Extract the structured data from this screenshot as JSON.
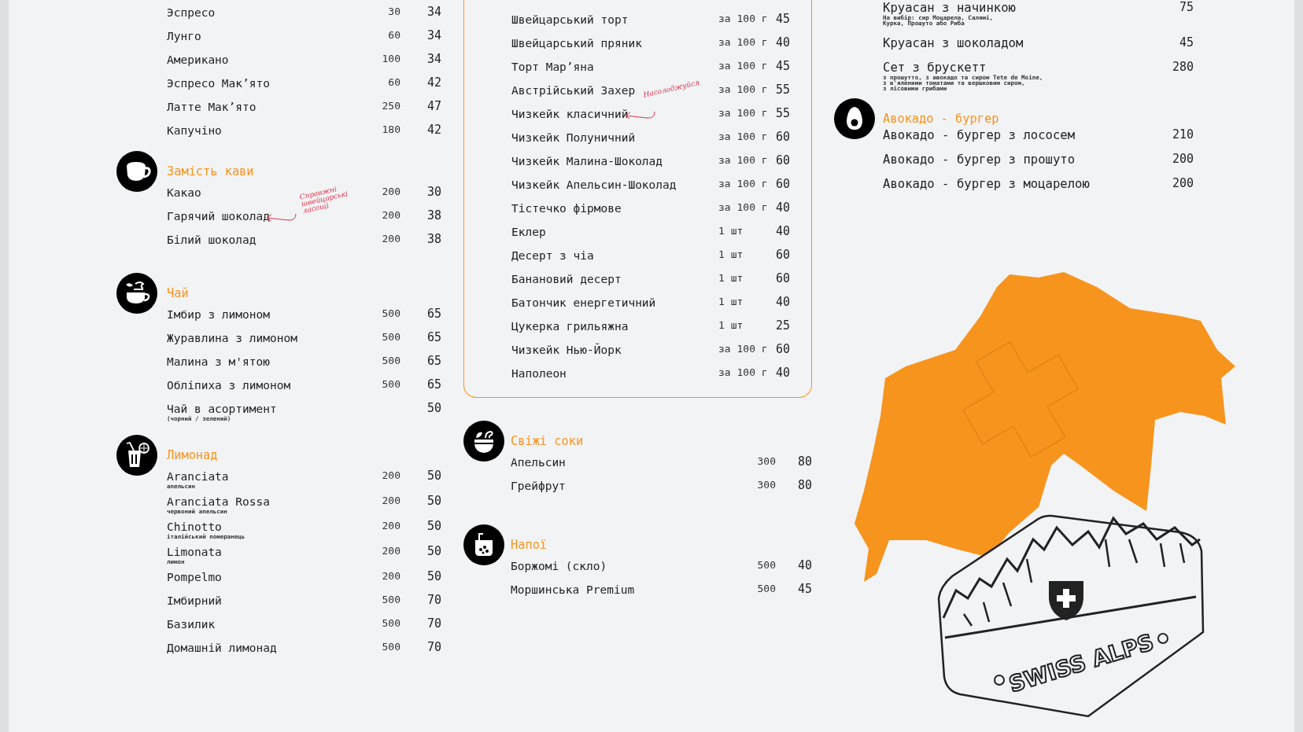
{
  "left_column": {
    "sections": [
      {
        "items": [
          {
            "name": "Эспресо",
            "amount": "30",
            "price": "34"
          },
          {
            "name": "Лунго",
            "amount": "60",
            "price": "34"
          },
          {
            "name": "Американо",
            "amount": "100",
            "price": "34"
          },
          {
            "name": "Эспресо Мак’ято",
            "amount": "60",
            "price": "42"
          },
          {
            "name": "Латте Мак’ято",
            "amount": "250",
            "price": "47"
          },
          {
            "name": "Капучіно",
            "amount": "180",
            "price": "42"
          }
        ]
      },
      {
        "kind": "cup",
        "title": "Замість кави",
        "items": [
          {
            "name": "Какао",
            "amount": "200",
            "price": "30"
          },
          {
            "name": "Гарячий шоколад",
            "amount": "200",
            "price": "38",
            "handwritten_note": "Справжні швейцарські ласощі"
          },
          {
            "name": "Білий шоколад",
            "amount": "200",
            "price": "38"
          }
        ]
      },
      {
        "kind": "tea",
        "title": "Чай",
        "items": [
          {
            "name": "Імбир з лимоном",
            "amount": "500",
            "price": "65"
          },
          {
            "name": "Журавлина з лимоном",
            "amount": "500",
            "price": "65"
          },
          {
            "name": "Малина з м'ятою",
            "amount": "500",
            "price": "65"
          },
          {
            "name": "Обліпиха з лимоном",
            "amount": "500",
            "price": "65"
          },
          {
            "name": "Чай в асортимент",
            "note": "(чорний / зелений)",
            "price": "50"
          }
        ]
      },
      {
        "kind": "lemonade",
        "title": "Лимонад",
        "items": [
          {
            "name": "Aranciata",
            "note": "апельсин",
            "amount": "200",
            "price": "50"
          },
          {
            "name": "Aranciata Rossa",
            "note": "червоний апельсин",
            "amount": "200",
            "price": "50"
          },
          {
            "name": "Chinotto",
            "note": "італійський померанець",
            "amount": "200",
            "price": "50"
          },
          {
            "name": "Limonata",
            "note": "лимон",
            "amount": "200",
            "price": "50"
          },
          {
            "name": "Pompelmo",
            "amount": "200",
            "price": "50"
          },
          {
            "name": "Імбирний",
            "amount": "500",
            "price": "70"
          },
          {
            "name": "Базилик",
            "amount": "500",
            "price": "70"
          },
          {
            "name": "Домашній лимонад",
            "amount": "500",
            "price": "70"
          }
        ]
      }
    ]
  },
  "middle_column": {
    "sections": [
      {
        "framed": true,
        "items": [
          {
            "name": "Швейцарський торт",
            "amount": "за 100 г",
            "price": "45"
          },
          {
            "name": "Швейцарський пряник",
            "amount": "за 100 г",
            "price": "40"
          },
          {
            "name": "Торт Мар’яна",
            "amount": "за 100 г",
            "price": "45"
          },
          {
            "name": "Австрійський Захер",
            "amount": "за 100 г",
            "price": "55"
          },
          {
            "name": "Чизкейк класичний",
            "amount": "за 100 г",
            "price": "55",
            "handwritten_note": "Насолоджуйся"
          },
          {
            "name": "Чизкейк Полуничний",
            "amount": "за 100 г",
            "price": "60"
          },
          {
            "name": "Чизкейк Малина-Шоколад",
            "amount": "за 100 г",
            "price": "60"
          },
          {
            "name": "Чизкейк Апельсин-Шоколад",
            "amount": "за 100 г",
            "price": "60"
          },
          {
            "name": "Тістечко фірмове",
            "amount": "за 100 г",
            "price": "40"
          },
          {
            "name": "Еклер",
            "amount": "1 шт",
            "price": "40"
          },
          {
            "name": "Десерт з чіа",
            "amount": "1 шт",
            "price": "60"
          },
          {
            "name": "Банановий десерт",
            "amount": "1 шт",
            "price": "60"
          },
          {
            "name": "Батончик енергетичний",
            "amount": "1 шт",
            "price": "40"
          },
          {
            "name": "Цукерка грильяжна",
            "amount": "1 шт",
            "price": "25"
          },
          {
            "name": "Чизкейк Нью-Йорк",
            "amount": "за 100 г",
            "price": "60"
          },
          {
            "name": "Наполеон",
            "amount": "за 100 г",
            "price": "40"
          }
        ]
      },
      {
        "framed": false,
        "kind": "juice",
        "title": "Свіжі соки",
        "items": [
          {
            "name": "Апельсин",
            "amount": "300",
            "price": "80"
          },
          {
            "name": "Грейфрут",
            "amount": "300",
            "price": "80"
          }
        ]
      },
      {
        "framed": false,
        "kind": "drink",
        "title": "Напої",
        "items": [
          {
            "name": "Боржомі (скло)",
            "amount": "500",
            "price": "40"
          },
          {
            "name": "Моршинська Premium",
            "amount": "500",
            "price": "45"
          }
        ]
      }
    ]
  },
  "right_column": {
    "sections": [
      {
        "items": [
          {
            "name": "Круасан з начинкою",
            "note": "На вибір: сир Моцарела, Салямі,\nКурка, Прошуто або Риба",
            "price": "75"
          },
          {
            "name": "Круасан з шоколадом",
            "price": "45"
          },
          {
            "name": "Сет з брускетт",
            "note": "з прошутто, з авокадо та сиром Tete de Moine,\nз в'яленими томатами та вершковим сиром,\nз лісовими грибами",
            "price": "280"
          }
        ]
      },
      {
        "kind": "avocado",
        "title": "Авокадо - бургер",
        "items": [
          {
            "name": "Авокадо - бургер з лососем",
            "price": "210"
          },
          {
            "name": "Авокадо - бургер з прошуто",
            "price": "200"
          },
          {
            "name": "Авокадо - бургер з моцарелою",
            "price": "200"
          }
        ]
      }
    ],
    "illustration": {
      "badge_text": "SWISS ALPS"
    }
  }
}
